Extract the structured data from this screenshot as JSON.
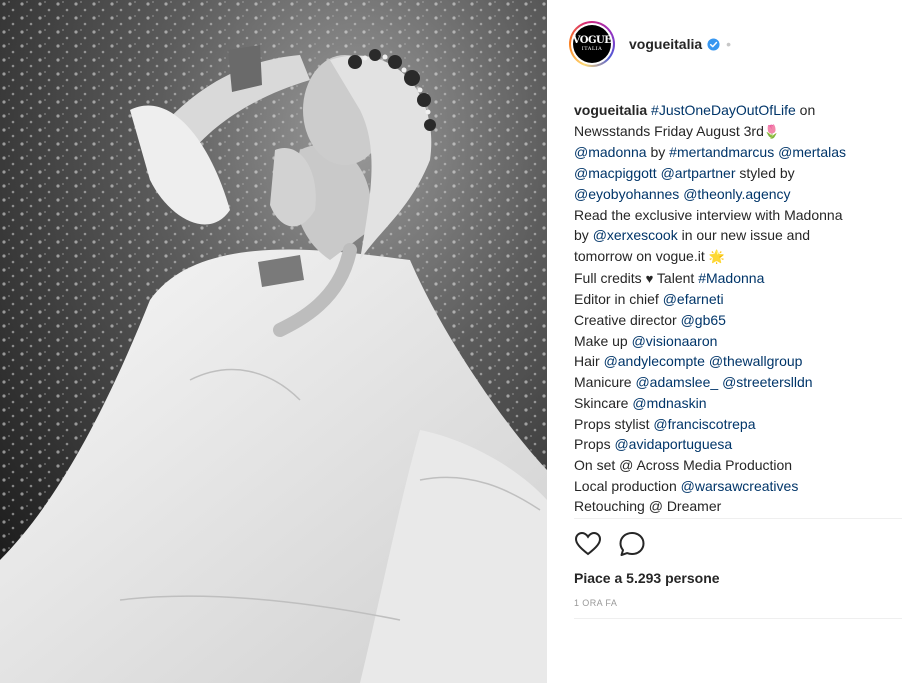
{
  "post": {
    "photo_alt": "Black and white photo of Madonna in a white lace dress with a flower crown, kneeling in a field of flowers",
    "account": {
      "username": "vogueitalia",
      "avatar_logo_main": "VOGUE",
      "avatar_logo_sub": "ITALIA",
      "verified": true,
      "follow_dot": "•"
    },
    "caption": {
      "username": "vogueitalia",
      "lines": [
        [
          {
            "t": "user",
            "v": "vogueitalia"
          },
          {
            "t": "text",
            "v": " "
          },
          {
            "t": "link",
            "v": "#JustOneDayOutOfLife"
          },
          {
            "t": "text",
            "v": " on"
          }
        ],
        [
          {
            "t": "text",
            "v": "Newsstands Friday August 3rd"
          },
          {
            "t": "emoji",
            "v": "🌷"
          }
        ],
        [
          {
            "t": "link",
            "v": "@madonna"
          },
          {
            "t": "text",
            "v": " by "
          },
          {
            "t": "link",
            "v": "#mertandmarcus"
          },
          {
            "t": "text",
            "v": " "
          },
          {
            "t": "link",
            "v": "@mertalas"
          }
        ],
        [
          {
            "t": "link",
            "v": "@macpiggott"
          },
          {
            "t": "text",
            "v": " "
          },
          {
            "t": "link",
            "v": "@artpartner"
          },
          {
            "t": "text",
            "v": " styled by"
          }
        ],
        [
          {
            "t": "link",
            "v": "@eyobyohannes"
          },
          {
            "t": "text",
            "v": " "
          },
          {
            "t": "link",
            "v": "@theonly.agency"
          }
        ],
        [
          {
            "t": "text",
            "v": "Read the exclusive interview with Madonna"
          }
        ],
        [
          {
            "t": "text",
            "v": "by "
          },
          {
            "t": "link",
            "v": "@xerxescook"
          },
          {
            "t": "text",
            "v": " in our new issue and"
          }
        ],
        [
          {
            "t": "text",
            "v": "tomorrow on vogue.it "
          },
          {
            "t": "emoji",
            "v": "🌟"
          }
        ],
        [
          {
            "t": "text",
            "v": "Full credits "
          },
          {
            "t": "emoji",
            "v": "♥"
          },
          {
            "t": "text",
            "v": " Talent "
          },
          {
            "t": "link",
            "v": "#Madonna"
          }
        ],
        [
          {
            "t": "text",
            "v": "Editor in chief "
          },
          {
            "t": "link",
            "v": "@efarneti"
          }
        ],
        [
          {
            "t": "text",
            "v": "Creative director "
          },
          {
            "t": "link",
            "v": "@gb65"
          }
        ],
        [
          {
            "t": "text",
            "v": "Make up "
          },
          {
            "t": "link",
            "v": "@visionaaron"
          }
        ],
        [
          {
            "t": "text",
            "v": "Hair "
          },
          {
            "t": "link",
            "v": "@andylecompte"
          },
          {
            "t": "text",
            "v": " "
          },
          {
            "t": "link",
            "v": "@thewallgroup"
          }
        ],
        [
          {
            "t": "text",
            "v": "Manicure "
          },
          {
            "t": "link",
            "v": "@adamslee_"
          },
          {
            "t": "text",
            "v": " "
          },
          {
            "t": "link",
            "v": "@streeterslldn"
          }
        ],
        [
          {
            "t": "text",
            "v": "Skincare "
          },
          {
            "t": "link",
            "v": "@mdnaskin"
          }
        ],
        [
          {
            "t": "text",
            "v": "Props stylist "
          },
          {
            "t": "link",
            "v": "@franciscotrepa"
          }
        ],
        [
          {
            "t": "text",
            "v": "Props "
          },
          {
            "t": "link",
            "v": "@avidaportuguesa"
          }
        ],
        [
          {
            "t": "text",
            "v": "On set @ Across Media Production"
          }
        ],
        [
          {
            "t": "text",
            "v": "Local production "
          },
          {
            "t": "link",
            "v": "@warsawcreatives"
          }
        ],
        [
          {
            "t": "text",
            "v": "Retouching @ Dreamer"
          }
        ]
      ]
    },
    "actions": {
      "like_icon": "heart-outline-icon",
      "comment_icon": "speech-bubble-icon"
    },
    "likes_text": "Piace a 5.293 persone",
    "timestamp": "1 ORA FA",
    "colors": {
      "link": "#003569",
      "text": "#262626",
      "muted": "#999999",
      "verified": "#3897f0"
    }
  }
}
